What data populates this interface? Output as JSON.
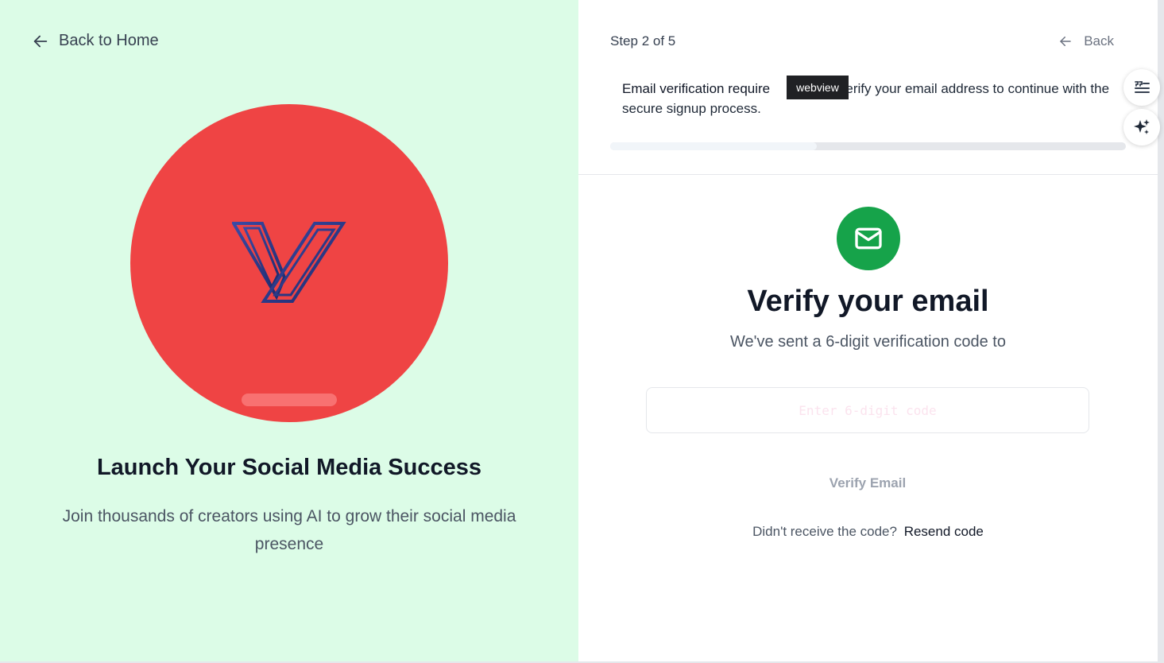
{
  "left_panel": {
    "back_label": "Back to Home",
    "hero_title": "Launch Your Social Media Success",
    "hero_subtitle": "Join thousands of creators using AI to grow their social media presence",
    "background_color": "#dcfce7",
    "hero_circle_color": "#ef4444"
  },
  "right_panel": {
    "step_label": "Step 2 of 5",
    "back_label": "Back",
    "notice_lead": "Email verification require",
    "notice_rest": " verify your email address to continue with the secure signup process.",
    "tooltip_text": "webview",
    "progress_fraction": 0.4,
    "title": "Verify your email",
    "subtitle": "We've sent a 6-digit verification code to",
    "code_input": {
      "placeholder": "Enter 6-digit code",
      "value": ""
    },
    "verify_button_label": "Verify Email",
    "resend_prompt": "Didn't receive the code?",
    "resend_link_label": "Resend code",
    "accent_color": "#16a34a"
  },
  "floating_tools": {
    "items": [
      "quote-list-icon",
      "sparkle-icon"
    ]
  }
}
